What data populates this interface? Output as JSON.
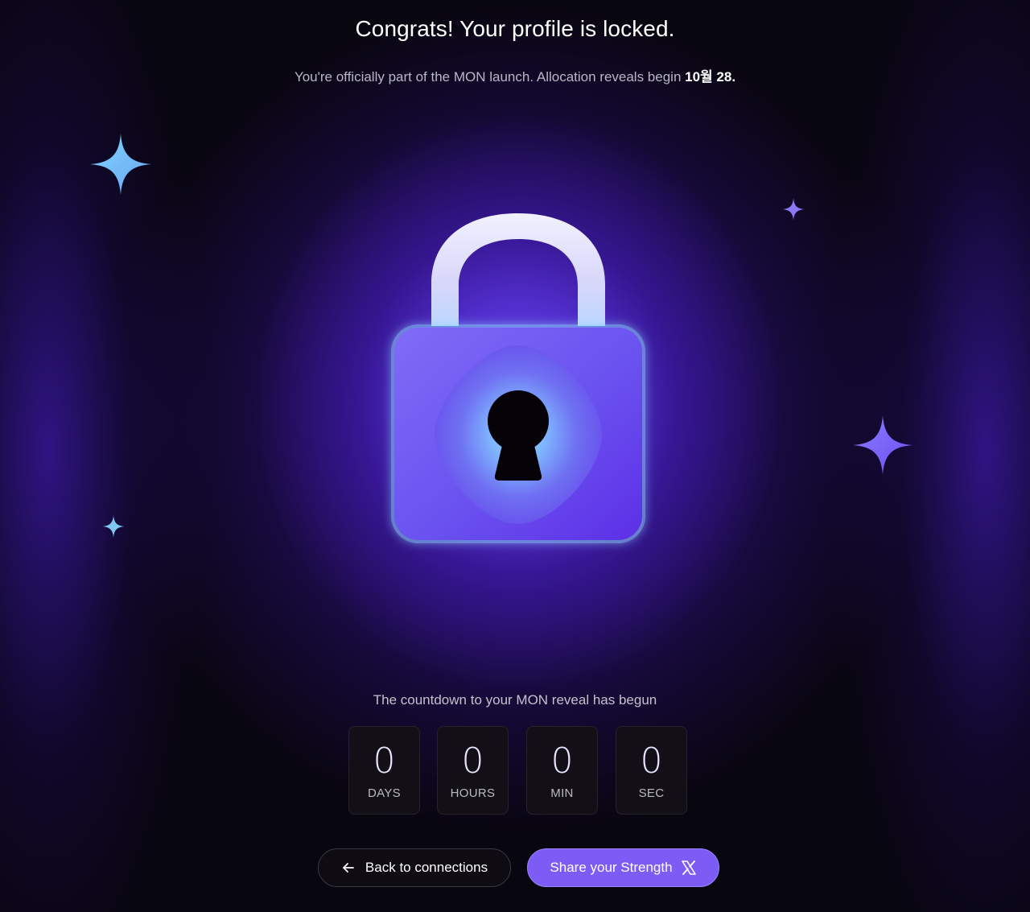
{
  "header": {
    "title": "Congrats! Your profile is locked.",
    "subtitle_text": "You're officially part of the MON launch. Allocation reveals begin ",
    "subtitle_date": "10월 28."
  },
  "countdown": {
    "label": "The countdown to your MON reveal has begun",
    "units": [
      {
        "value": "0",
        "label": "DAYS"
      },
      {
        "value": "0",
        "label": "HOURS"
      },
      {
        "value": "0",
        "label": "MIN"
      },
      {
        "value": "0",
        "label": "SEC"
      }
    ]
  },
  "actions": {
    "back_label": "Back to connections",
    "back_icon": "arrow-left-icon",
    "share_label": "Share your Strength",
    "share_icon": "x-logo-icon"
  },
  "illustration": {
    "icon": "padlock-icon",
    "sparkle_icons": [
      "sparkle-icon"
    ]
  },
  "colors": {
    "accent": "#7d5cf6",
    "background": "#08060f",
    "glow": "#6b4cf0"
  }
}
